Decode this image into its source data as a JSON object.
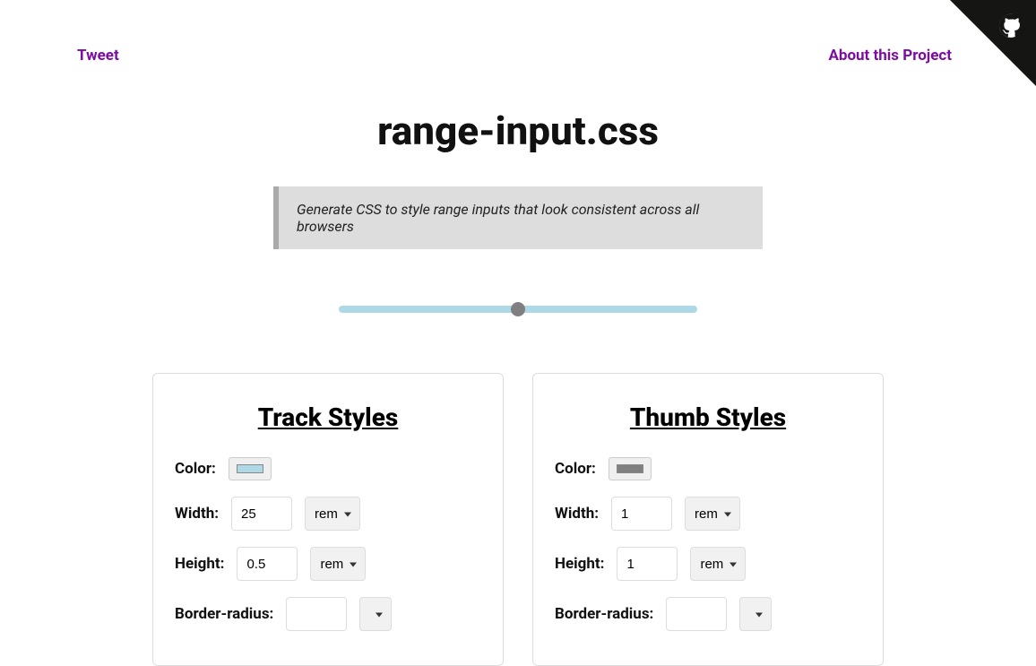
{
  "header": {
    "tweet_label": "Tweet",
    "about_label": "About this Project"
  },
  "page_title": "range-input.css",
  "tagline": "Generate CSS to style range inputs that look consistent across all browsers",
  "preview": {
    "track_color": "#add8e6",
    "thumb_color": "#808080"
  },
  "panels": {
    "track": {
      "heading": "Track Styles",
      "color_label": "Color:",
      "color_value": "#add8e6",
      "width_label": "Width:",
      "width_value": "25",
      "width_unit": "rem",
      "height_label": "Height:",
      "height_value": "0.5",
      "height_unit": "rem",
      "radius_label": "Border-radius:"
    },
    "thumb": {
      "heading": "Thumb Styles",
      "color_label": "Color:",
      "color_value": "#808080",
      "width_label": "Width:",
      "width_value": "1",
      "width_unit": "rem",
      "height_label": "Height:",
      "height_value": "1",
      "height_unit": "rem",
      "radius_label": "Border-radius:"
    }
  },
  "github_icon": "github-icon"
}
